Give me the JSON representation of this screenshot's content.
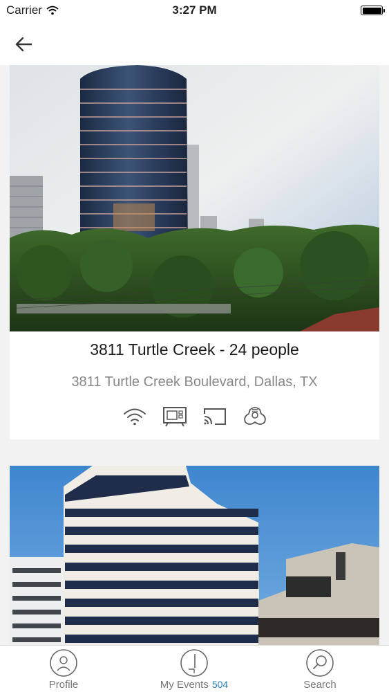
{
  "status_bar": {
    "carrier": "Carrier",
    "time": "3:27 PM",
    "icons": [
      "wifi-icon",
      "battery-icon"
    ]
  },
  "nav": {
    "back_icon": "arrow-left-icon"
  },
  "listings": [
    {
      "title": "3811 Turtle Creek - 24 people",
      "address": "3811 Turtle Creek Boulevard, Dallas, TX",
      "photo": "glass-office-tower-photo",
      "amenities": [
        "wifi-icon",
        "tv-screen-icon",
        "screen-cast-icon",
        "conference-phone-icon"
      ]
    },
    {
      "title": "",
      "address": "",
      "photo": "striped-office-building-photo",
      "amenities": []
    }
  ],
  "tab_bar": {
    "tabs": [
      {
        "label": "Profile",
        "icon": "profile-icon"
      },
      {
        "label": "My Events",
        "badge": "504",
        "icon": "my-events-icon"
      },
      {
        "label": "Search",
        "icon": "search-icon"
      }
    ]
  },
  "colors": {
    "background": "#f2f2f2",
    "card": "#ffffff",
    "badge": "#2a7fb8",
    "secondary_text": "#888888"
  }
}
